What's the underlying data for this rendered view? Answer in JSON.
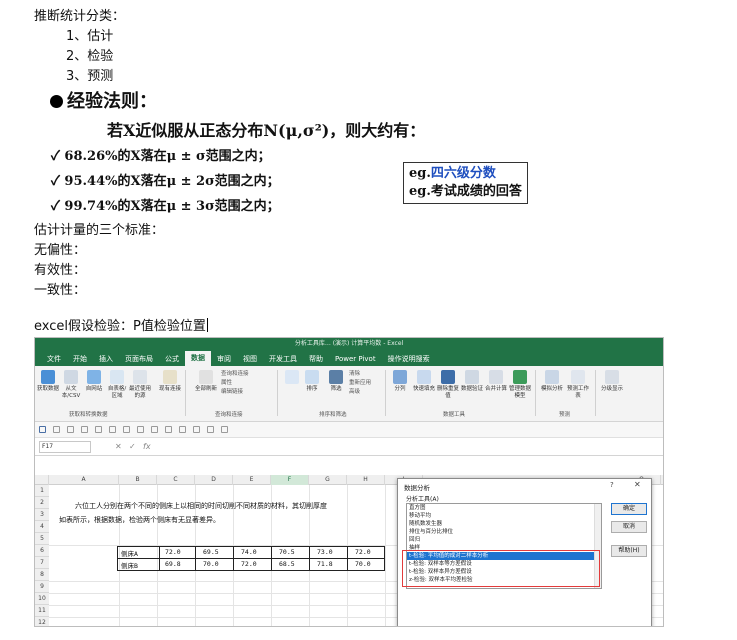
{
  "notes": {
    "heading": "推断统计分类：",
    "items": [
      "1、估计",
      "2、检验",
      "3、预测"
    ]
  },
  "slide": {
    "rule_title": "经验法则：",
    "formula_line": "若X近似服从正态分布N(μ,σ²)，则大约有：",
    "bullets": [
      "68.26%的X落在μ ± σ范围之内；",
      "95.44%的X落在μ ± 2σ范围之内；",
      "99.74%的X落在μ ± 3σ范围之内；"
    ],
    "check_mark": "✓",
    "eg1_prefix": "eg.",
    "eg1_text": "四六级分数",
    "eg2": "eg.考试成绩的回答",
    "eg_highlight_color": "#1f4fbf"
  },
  "notes2": {
    "heading": "估计计量的三个标准：",
    "items": [
      "无偏性：",
      "有效性：",
      "一致性："
    ]
  },
  "excel_note": "excel假设检验：P值检验位置",
  "excel": {
    "title": "分析工具库…  (演示)  计算平均数 - Excel",
    "accent_color": "#217346",
    "menu_tabs": [
      "文件",
      "开始",
      "插入",
      "页面布局",
      "公式",
      "数据",
      "审阅",
      "视图",
      "开发工具",
      "帮助",
      "Power Pivot",
      "操作说明搜索"
    ],
    "active_tab": "数据",
    "ribbon_groups": [
      "获取和转换数据",
      "查询和连接",
      "排序和筛选",
      "数据工具",
      "预测"
    ],
    "ribbon_buttons": [
      "获取数据",
      "从文本/CSV",
      "自网站",
      "自表格/区域",
      "最近使用的源",
      "现有连接",
      "全部刷新",
      "排序",
      "筛选",
      "分列",
      "快速填充",
      "删除重复值",
      "数据验证",
      "合并计算",
      "管理数据模型",
      "模拟分析",
      "预测工作表",
      "分级显示"
    ],
    "ribbon_small": [
      "查询和连接",
      "属性",
      "编辑链接",
      "清除",
      "重新应用",
      "高级"
    ],
    "name_box": "F17",
    "columns": [
      "A",
      "B",
      "C",
      "D",
      "E",
      "F",
      "G",
      "H",
      "I",
      "J",
      "K",
      "L",
      "M",
      "N",
      "O"
    ],
    "rows": [
      "1",
      "2",
      "3",
      "4",
      "5",
      "6",
      "7",
      "8",
      "9",
      "10",
      "11",
      "12"
    ],
    "sheet_line1": "六位工人分别在两个不同的侧床上以相同的时间切削不同材质的材料，其切削厚度",
    "sheet_line2": "如表所示，根据数据，检验两个侧床有无显著差异。",
    "table": {
      "row1": [
        "侧床A",
        "72.0",
        "69.5",
        "74.0",
        "70.5",
        "73.0",
        "72.0"
      ],
      "row2": [
        "侧床B",
        "69.8",
        "70.0",
        "72.0",
        "68.5",
        "71.8",
        "70.0"
      ]
    }
  },
  "dialog": {
    "title": "数据分析",
    "help_glyph": "?",
    "close_glyph": "✕",
    "label": "分析工具(A)",
    "list": [
      "直方图",
      "移动平均",
      "随机数发生器",
      "排位与百分比排位",
      "回归",
      "抽样",
      "t-检验: 平均值的成对二样本分析",
      "t-检验: 双样本等方差假设",
      "t-检验: 双样本异方差假设",
      "z-检验: 双样本平均差检验"
    ],
    "selected_index": 6,
    "buttons": [
      "确定",
      "取消",
      "帮助(H)"
    ]
  }
}
